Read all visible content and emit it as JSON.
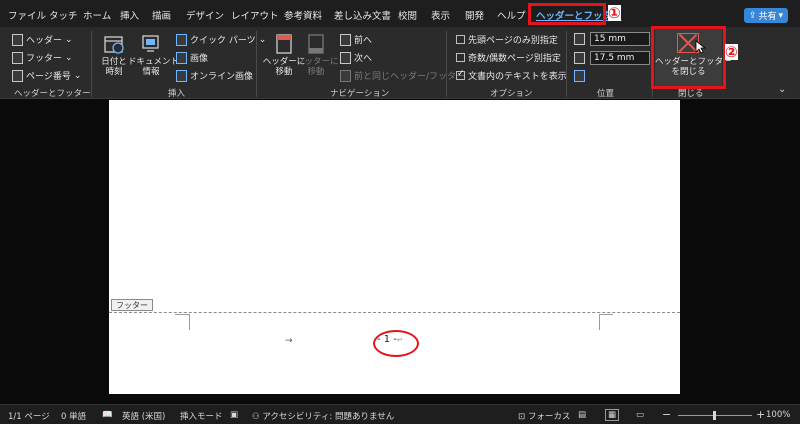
{
  "menubar": {
    "tabs": [
      "ファイル",
      "タッチ",
      "ホーム",
      "挿入",
      "描画",
      "デザイン",
      "レイアウト",
      "参考資料",
      "差し込み文書",
      "校閲",
      "表示",
      "開発",
      "ヘルプ",
      "ヘッダーとフッター"
    ],
    "active_tab": "ヘッダーとフッター",
    "share_label": "共有",
    "annotation_1": "①"
  },
  "ribbon": {
    "groups": {
      "header_footer": {
        "label": "ヘッダーとフッター",
        "header": "ヘッダー",
        "footer": "フッター",
        "page_number": "ページ番号"
      },
      "insert": {
        "label": "挿入",
        "datetime": "日付と\n時刻",
        "docinfo": "ドキュメント\n情報",
        "quickparts": "クイック パーツ",
        "image": "画像",
        "online_image": "オンライン画像"
      },
      "navigation": {
        "label": "ナビゲーション",
        "goto_header": "ヘッダーに\n移動",
        "goto_footer": "フッターに\n移動",
        "prev": "前へ",
        "next": "次へ",
        "link_prev": "前と同じヘッダー/フッター"
      },
      "options": {
        "label": "オプション",
        "first_page": "先頭ページのみ別指定",
        "odd_even": "奇数/偶数ページ別指定",
        "show_text": "文書内のテキストを表示",
        "first_page_checked": false,
        "odd_even_checked": false,
        "show_text_checked": true
      },
      "position": {
        "label": "位置",
        "header_pos": "15 mm",
        "footer_pos": "17.5 mm"
      },
      "close": {
        "label": "閉じる",
        "close_btn": "ヘッダーとフッター\nを閉じる",
        "annotation_2": "②"
      }
    }
  },
  "document": {
    "footer_tag": "フッター",
    "page_number": "- 1 -",
    "para_mark": "↵",
    "tab_arrow": "→"
  },
  "statusbar": {
    "page": "1/1 ページ",
    "words": "0 単語",
    "language": "英語 (米国)",
    "mode": "挿入モード",
    "accessibility": "アクセシビリティ: 問題ありません",
    "focus": "フォーカス",
    "zoom": "100%",
    "zoom_level": 100
  },
  "colors": {
    "annotation_red": "#e3141c",
    "active_tab_blue": "#6fb7ff",
    "share_blue": "#3a86d6"
  }
}
